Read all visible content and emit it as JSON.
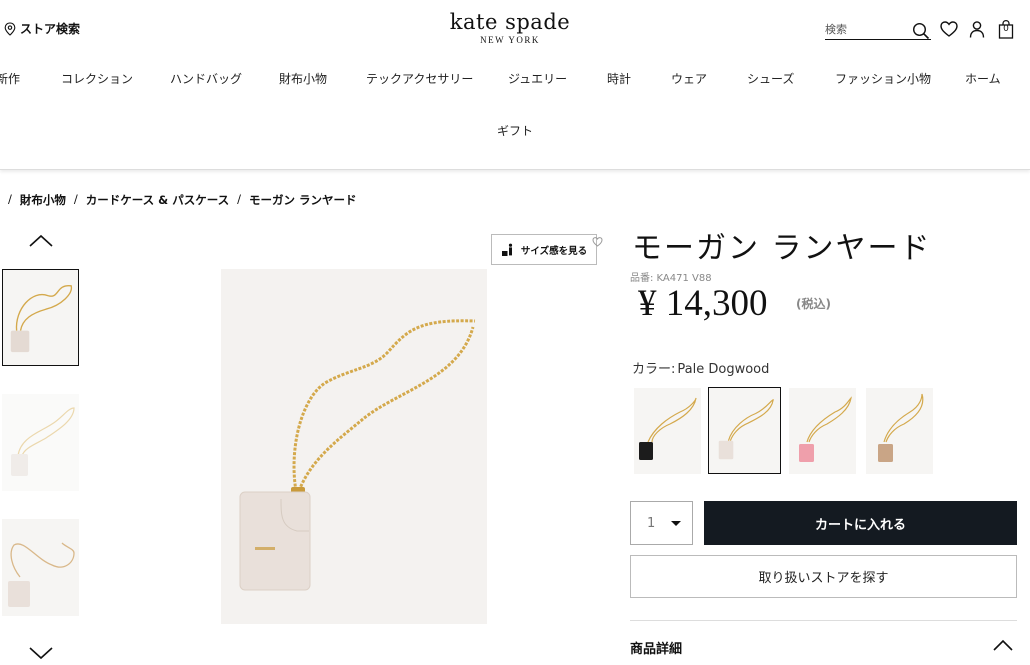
{
  "header": {
    "store_link": "ストア検索",
    "logo": {
      "brand": "kate spade",
      "sub": "NEW YORK"
    },
    "search_placeholder": "検索",
    "bag_count": "0"
  },
  "nav": {
    "items": [
      "新作",
      "コレクション",
      "ハンドバッグ",
      "財布小物",
      "テックアクセサリー",
      "ジュエリー",
      "時計",
      "ウェア",
      "シューズ",
      "ファッション小物",
      "ホーム"
    ],
    "row2": "ギフト"
  },
  "breadcrumb": {
    "items": [
      "財布小物",
      "カードケース & パスケース",
      "モーガン ランヤード"
    ],
    "separator": "/"
  },
  "size_button": "サイズ感を見る",
  "product": {
    "title": "モーガン ランヤード",
    "sku": "品番: KA471 V88",
    "price": "¥ 14,300",
    "tax": "(税込)",
    "color_label": "カラー:",
    "color_value": "Pale Dogwood",
    "swatch_colors": [
      "#1c1c1c",
      "#e9e0da",
      "#ef9fab",
      "#c9a586"
    ],
    "selected_swatch": 1,
    "quantity": "1",
    "cart_button": "カートに入れる",
    "store_button": "取り扱いストアを探す",
    "details_title": "商品詳細"
  },
  "colors": {
    "accent": "#141a21",
    "image_bg": "#f4f2f0",
    "card_case": "#e9e0da",
    "chain": "#d4a94c"
  }
}
